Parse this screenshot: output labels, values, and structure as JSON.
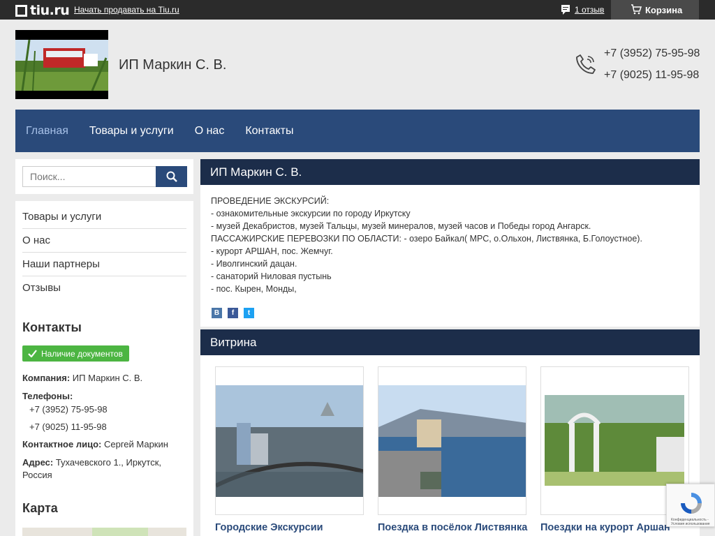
{
  "topbar": {
    "logo_text": "tiu.ru",
    "sell_link": "Начать продавать на Tiu.ru",
    "reviews_link": "1 отзыв",
    "cart_label": "Корзина"
  },
  "header": {
    "company_name": "ИП Маркин С. В.",
    "phones": [
      "+7 (3952) 75-95-98",
      "+7 (9025) 11-95-98"
    ]
  },
  "nav": {
    "items": [
      {
        "label": "Главная",
        "active": true
      },
      {
        "label": "Товары и услуги",
        "active": false
      },
      {
        "label": "О нас",
        "active": false
      },
      {
        "label": "Контакты",
        "active": false
      }
    ]
  },
  "sidebar": {
    "search_placeholder": "Поиск...",
    "menu": [
      "Товары и услуги",
      "О нас",
      "Наши партнеры",
      "Отзывы"
    ],
    "contacts_heading": "Контакты",
    "docs_badge": "Наличие документов",
    "company_label": "Компания:",
    "company_value": "ИП Маркин С. В.",
    "phones_label": "Телефоны:",
    "phones": [
      "+7 (3952) 75-95-98",
      "+7 (9025) 11-95-98"
    ],
    "contact_person_label": "Контактное лицо:",
    "contact_person_value": "Сергей Маркин",
    "address_label": "Адрес:",
    "address_value": "Тухачевского 1., Иркутск,",
    "address_value_2": "Россия",
    "map_heading": "Карта"
  },
  "main": {
    "heading": "ИП Маркин С. В.",
    "description": [
      "ПРОВЕДЕНИЕ ЭКСКУРСИЙ:",
      "- ознакомительные экскурсии по городу Иркутску",
      "- музей Декабристов, музей Тальцы, музей минералов, музей часов и Победы город Ангарск.",
      "ПАССАЖИРСКИЕ ПЕРЕВОЗКИ ПО ОБЛАСТИ: - озеро Байкал( МРС, о.Ольхон, Листвянка, Б.Голоустное).",
      "- курорт АРШАН, пос. Жемчуг.",
      "- Иволгинский дацан.",
      "- санаторий Ниловая пустынь",
      "- пос. Кырен, Монды,"
    ],
    "social": [
      {
        "icon": "vk-icon",
        "glyph": "В",
        "color": "#4a76a8"
      },
      {
        "icon": "facebook-icon",
        "glyph": "f",
        "color": "#3b5998"
      },
      {
        "icon": "twitter-icon",
        "glyph": "t",
        "color": "#1da1f2"
      }
    ]
  },
  "vitrina": {
    "heading": "Витрина",
    "products": [
      {
        "name": "Городские Экскурсии",
        "image": "bridge-photo"
      },
      {
        "name": "Поездка в посёлок Листвянка",
        "image": "lake-town-photo"
      },
      {
        "name": "Поездки на курорт Аршан",
        "image": "park-gate-photo"
      }
    ]
  },
  "recaptcha": {
    "text": "Конфиденциальность - Условия использования"
  }
}
